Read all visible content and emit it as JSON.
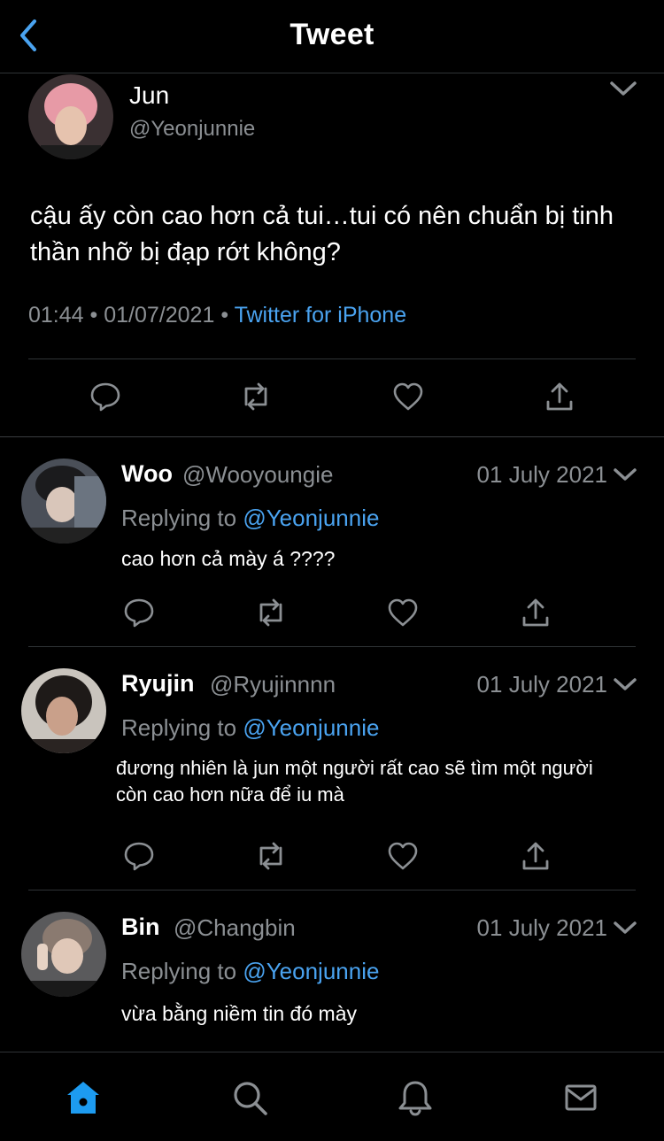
{
  "header": {
    "title": "Tweet",
    "back_icon": "chevron-left-icon"
  },
  "colors": {
    "accent": "#4aa3f0",
    "muted": "#8b8f93",
    "background": "#000000"
  },
  "main_tweet": {
    "name": "Jun",
    "handle": "@Yeonjunnie",
    "text": "cậu ấy còn cao hơn cả tui…tui có nên chuẩn bị tinh thần nhỡ bị đạp rớt không?",
    "time": "01:44",
    "date": "01/07/2021",
    "source": "Twitter for iPhone",
    "separator": "•"
  },
  "replies": [
    {
      "name": "Woo",
      "handle": "@Wooyoungie",
      "date": "01 July 2021",
      "replying_label": "Replying to",
      "mention": "@Yeonjunnie",
      "text": "cao hơn cả mày á ????"
    },
    {
      "name": "Ryujin",
      "handle": "@Ryujinnnn",
      "date": "01 July 2021",
      "replying_label": "Replying to",
      "mention": "@Yeonjunnie",
      "text": "đương nhiên là jun một người rất cao sẽ tìm một người còn cao hơn nữa để iu mà"
    },
    {
      "name": "Bin",
      "handle": "@Changbin",
      "date": "01 July 2021",
      "replying_label": "Replying to",
      "mention": "@Yeonjunnie",
      "text": "vừa bằng niềm tin đó mày"
    }
  ],
  "actions": [
    "reply-icon",
    "retweet-icon",
    "like-icon",
    "share-icon"
  ],
  "tabbar": {
    "items": [
      "home-icon",
      "search-icon",
      "notifications-icon",
      "messages-icon"
    ],
    "active": "home-icon"
  }
}
